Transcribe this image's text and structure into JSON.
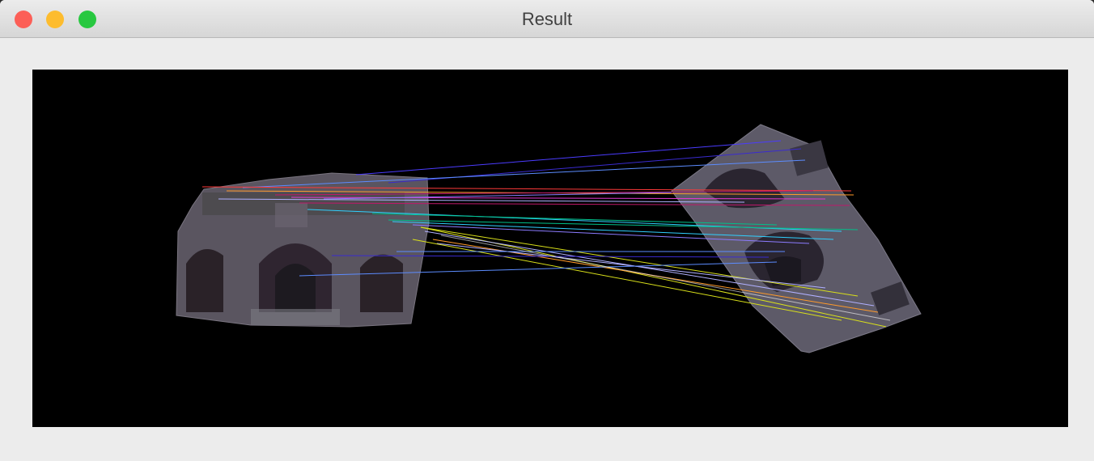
{
  "window": {
    "title": "Result",
    "traffic_lights": {
      "close": {
        "name": "close-button",
        "color": "#fc5f57"
      },
      "minimize": {
        "name": "minimize-button",
        "color": "#fdbc2e"
      },
      "zoom": {
        "name": "zoom-button",
        "color": "#28c840"
      }
    }
  },
  "result_image": {
    "description_icon": "image-view",
    "background": "#000000",
    "match_line_colors": [
      "#4b3cff",
      "#3a2bd0",
      "#ff3a3a",
      "#c0186b",
      "#00c08a",
      "#30d0ff",
      "#d9e01a",
      "#ff9a2a",
      "#8c7bff",
      "#e23ad0",
      "#5c8cff",
      "#b0b0ff"
    ]
  }
}
